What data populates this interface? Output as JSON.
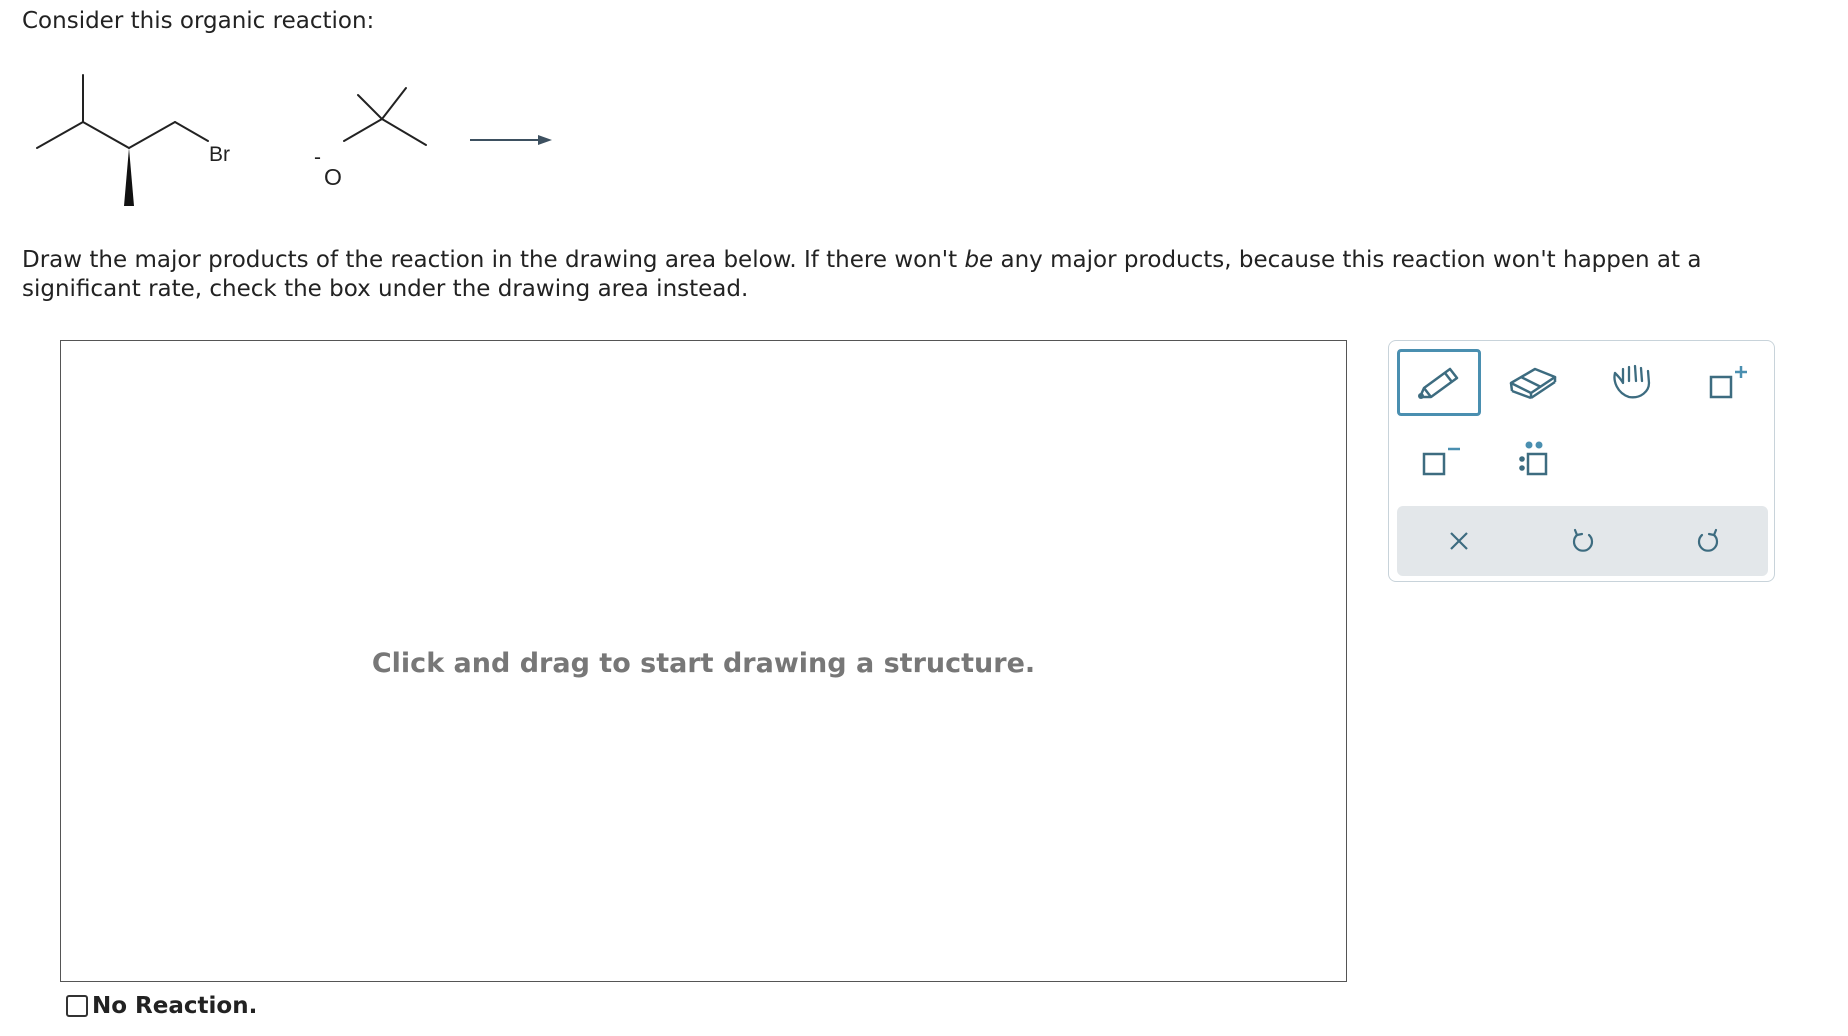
{
  "question": {
    "intro": "Consider this organic reaction:",
    "prompt_part1": "Draw the major products of the reaction in the drawing area below. If there won't ",
    "prompt_emph": "be",
    "prompt_part2": " any major products, because this reaction won't happen at a significant rate, check the box under the drawing area instead."
  },
  "reaction": {
    "substrate_label": "Br",
    "reagent_oxygen_label": "O",
    "reagent_charge": "-"
  },
  "drawing_area": {
    "hint": "Click and drag to start drawing a structure."
  },
  "toolbar": {
    "tools": [
      "pencil-tool",
      "eraser-tool",
      "hand-tool",
      "positive-charge-tool",
      "negative-charge-tool",
      "lone-pair-tool"
    ],
    "active_tool": "pencil-tool",
    "actions": [
      "clear-action",
      "undo-action",
      "redo-action"
    ],
    "accent_color": "#4a8fb0",
    "icon_color": "#3d6c80"
  },
  "no_reaction": {
    "label": "No Reaction.",
    "checked": false
  }
}
